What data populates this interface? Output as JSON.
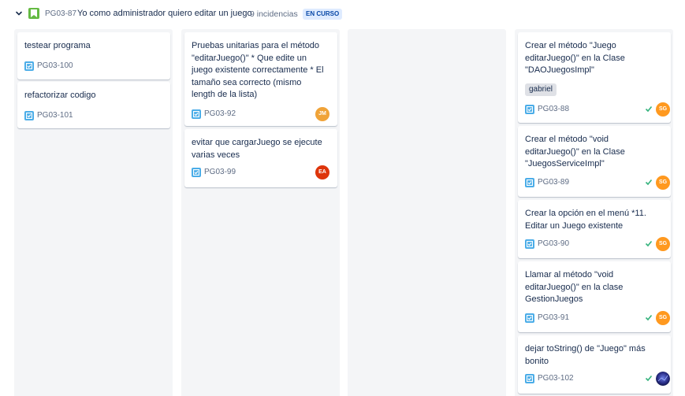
{
  "header": {
    "key": "PG03-87",
    "title": "Yo como administrador quiero editar un juego",
    "count": "9 incidencias",
    "status": "EN CURSO",
    "icons": {
      "toggle": "chevron-down-icon",
      "type": "story-icon"
    }
  },
  "colors": {
    "story": "#65ba43",
    "task": "#4bade8",
    "done_check": "#36b37e",
    "avatar_jm": "#f0a338",
    "avatar_ea": "#de350b",
    "avatar_sg": "#ff991f",
    "badge_bg": "#deebff",
    "badge_text": "#0747a6"
  },
  "columns": [
    {
      "cards": [
        {
          "text": "testear programa",
          "key": "PG03-100"
        },
        {
          "text": "refactorizar codigo",
          "key": "PG03-101"
        }
      ]
    },
    {
      "cards": [
        {
          "text": "Pruebas unitarias para el método \"editarJuego()\" * Que edite un juego existente correctamente * El tamaño sea correcto (mismo length de la lista)",
          "key": "PG03-92",
          "assignee": "JM"
        },
        {
          "text": "evitar que cargarJuego se ejecute varias veces",
          "key": "PG03-99",
          "assignee": "EA"
        }
      ]
    },
    {
      "cards": []
    },
    {
      "cards": [
        {
          "text": "Crear el método \"Juego editarJuego()\" en la Clase \"DAOJuegosImpl\"",
          "label": "gabriel",
          "key": "PG03-88",
          "assignee": "SG",
          "done": true
        },
        {
          "text": "Crear el método \"void editarJuego()\" en la Clase \"JuegosServiceImpl\"",
          "key": "PG03-89",
          "assignee": "SG",
          "done": true
        },
        {
          "text": "Crear la opción en el menú *11. Editar un Juego existente",
          "key": "PG03-90",
          "assignee": "SG",
          "done": true
        },
        {
          "text": "Llamar al método \"void editarJuego()\" en la clase GestionJuegos",
          "key": "PG03-91",
          "assignee": "SG",
          "done": true
        },
        {
          "text": "dejar toString() de \"Juego\" más bonito",
          "key": "PG03-102",
          "assignee_icon": "user-avatar-image",
          "done": true
        }
      ]
    }
  ]
}
